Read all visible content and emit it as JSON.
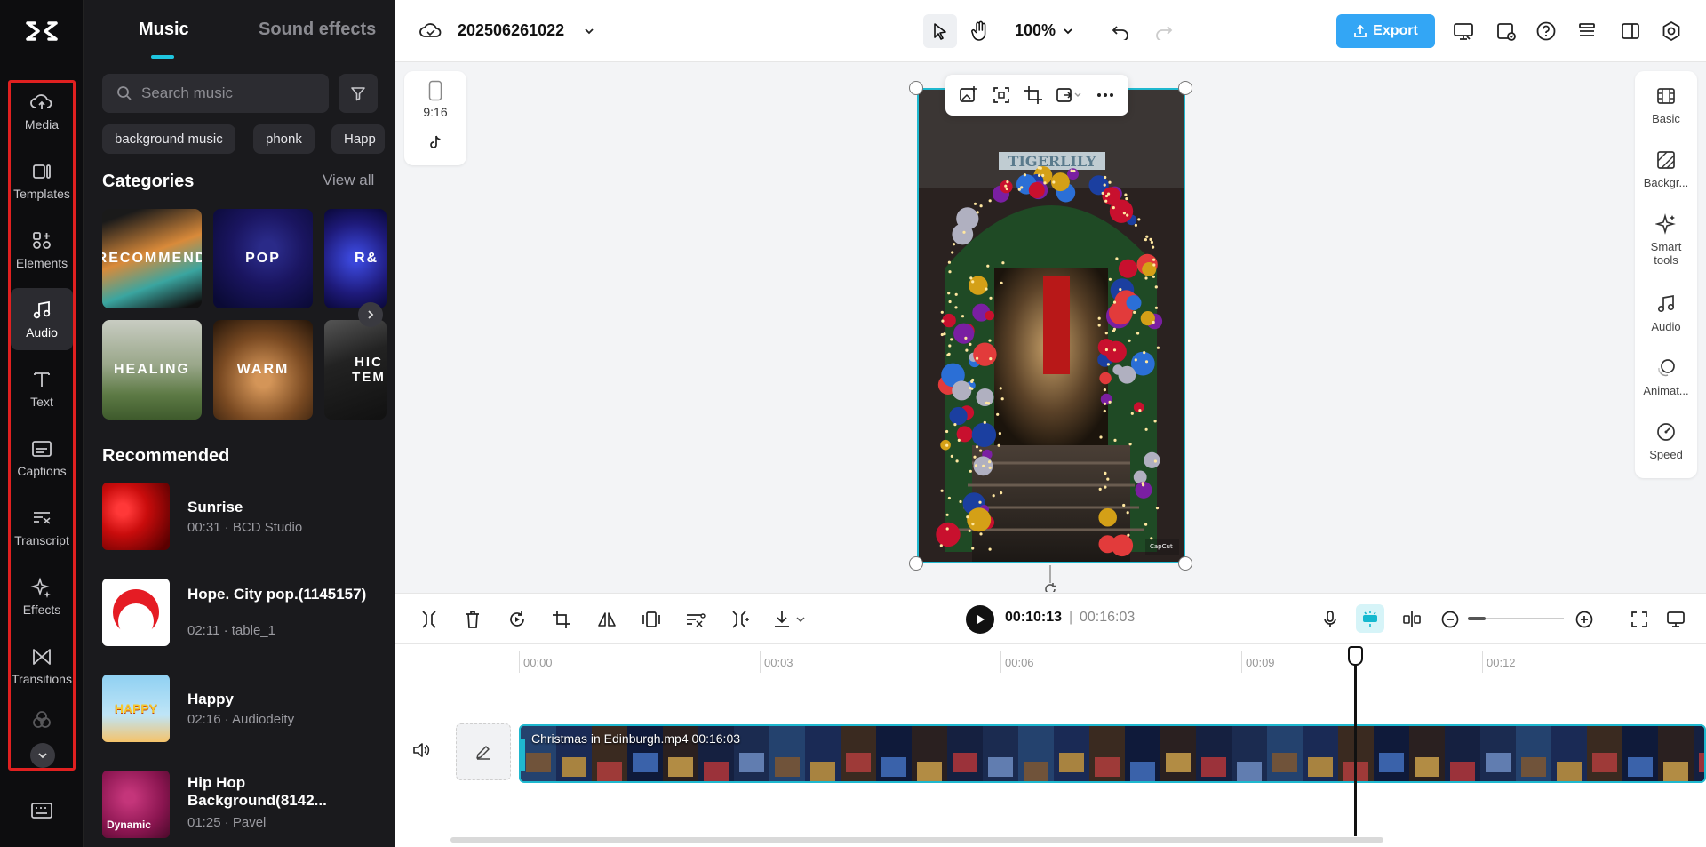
{
  "rail": {
    "items": [
      {
        "label": "Media",
        "icon": "cloud-upload-icon"
      },
      {
        "label": "Templates",
        "icon": "templates-icon"
      },
      {
        "label": "Elements",
        "icon": "elements-icon"
      },
      {
        "label": "Audio",
        "icon": "music-note-icon",
        "active": true
      },
      {
        "label": "Text",
        "icon": "text-icon"
      },
      {
        "label": "Captions",
        "icon": "captions-icon"
      },
      {
        "label": "Transcript",
        "icon": "transcript-icon"
      },
      {
        "label": "Effects",
        "icon": "sparkle-icon"
      },
      {
        "label": "Transitions",
        "icon": "transitions-icon"
      }
    ],
    "highlight_color": "#e02020"
  },
  "panel": {
    "tabs": [
      "Music",
      "Sound effects"
    ],
    "search_placeholder": "Search music",
    "chips": [
      "background music",
      "phonk",
      "Happ"
    ],
    "categories_title": "Categories",
    "view_all": "View all",
    "categories": [
      "RECOMMEND",
      "POP",
      "R&",
      "HEALING",
      "WARM",
      "HIC TEM"
    ],
    "recommended_title": "Recommended",
    "tracks": [
      {
        "name": "Sunrise",
        "meta": "00:31 · BCD Studio"
      },
      {
        "name": "Hope. City pop.(1145157)",
        "meta": "02:11 · table_1"
      },
      {
        "name": "Happy",
        "meta": "02:16 · Audiodeity",
        "cover_text": "HAPPY"
      },
      {
        "name": "Hip Hop Background(8142...",
        "meta": "01:25 · Pavel",
        "cover_text": "Dynamic"
      }
    ]
  },
  "topbar": {
    "project_name": "202506261022",
    "zoom": "100%",
    "export_label": "Export",
    "accent": "#33a6f5"
  },
  "canvas": {
    "ratio_label": "9:16",
    "preview_sign": "TIGERLILY",
    "watermark": "CapCut"
  },
  "right_panel": {
    "items": [
      "Basic",
      "Backgr...",
      "Smart tools",
      "Audio",
      "Animat...",
      "Speed"
    ]
  },
  "timeline": {
    "current_time": "00:10:13",
    "separator": "|",
    "total_time": "00:16:03",
    "ruler": [
      "00:00",
      "00:03",
      "00:06",
      "00:09",
      "00:12"
    ],
    "clip_label": "Christmas in Edinburgh.mp4  00:16:03"
  }
}
